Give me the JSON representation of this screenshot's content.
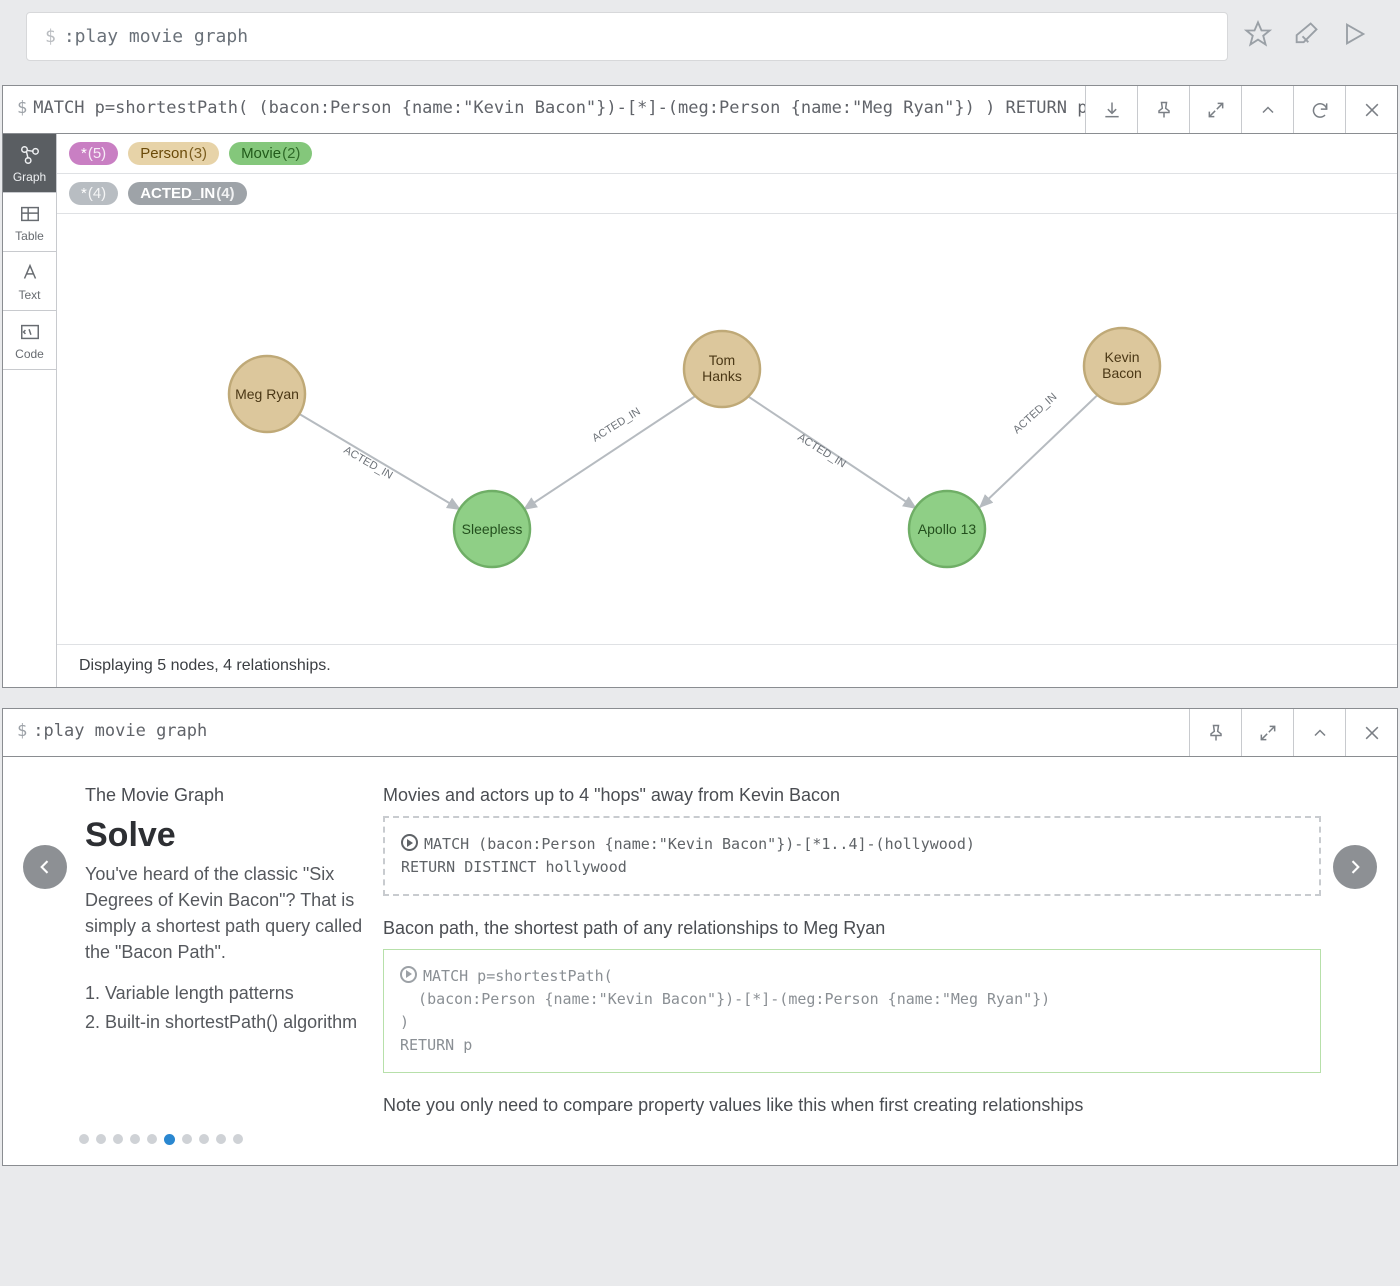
{
  "topbar": {
    "prompt": "$",
    "command": ":play movie graph"
  },
  "result": {
    "query_prompt": "$",
    "query": "MATCH p=shortestPath( (bacon:Person {name:\"Kevin Bacon\"})-[*]-(meg:Person {name:\"Meg Ryan\"}) ) RETURN p",
    "tabs": {
      "graph": "Graph",
      "table": "Table",
      "text": "Text",
      "code": "Code"
    },
    "legend_nodes": {
      "all": {
        "label": "*",
        "count": "(5)"
      },
      "person": {
        "label": "Person",
        "count": "(3)"
      },
      "movie": {
        "label": "Movie",
        "count": "(2)"
      }
    },
    "legend_rels": {
      "all": {
        "label": "*",
        "count": "(4)"
      },
      "acted": {
        "label": "ACTED_IN",
        "count": "(4)"
      }
    },
    "nodes": {
      "meg": "Meg Ryan",
      "sleepless": "Sleepless",
      "tom_l1": "Tom",
      "tom_l2": "Hanks",
      "apollo": "Apollo 13",
      "kevin_l1": "Kevin",
      "kevin_l2": "Bacon"
    },
    "edge_label": "ACTED_IN",
    "status": "Displaying 5 nodes, 4 relationships."
  },
  "guide": {
    "query_prompt": "$",
    "query": ":play movie graph",
    "subtitle": "The Movie Graph",
    "title": "Solve",
    "intro": "You've heard of the classic \"Six Degrees of Kevin Bacon\"? That is simply a shortest path query called the \"Bacon Path\".",
    "bullets": {
      "b1": "Variable length patterns",
      "b2": "Built-in shortestPath() algorithm"
    },
    "caption1": "Movies and actors up to 4 \"hops\" away from Kevin Bacon",
    "code1": "MATCH (bacon:Person {name:\"Kevin Bacon\"})-[*1..4]-(hollywood)\nRETURN DISTINCT hollywood",
    "caption2": "Bacon path, the shortest path of any relationships to Meg Ryan",
    "code2": "MATCH p=shortestPath(\n  (bacon:Person {name:\"Kevin Bacon\"})-[*]-(meg:Person {name:\"Meg Ryan\"})\n)\nRETURN p",
    "note": "Note you only need to compare property values like this when first creating relationships",
    "pager": {
      "total": 10,
      "active_index": 5
    }
  }
}
